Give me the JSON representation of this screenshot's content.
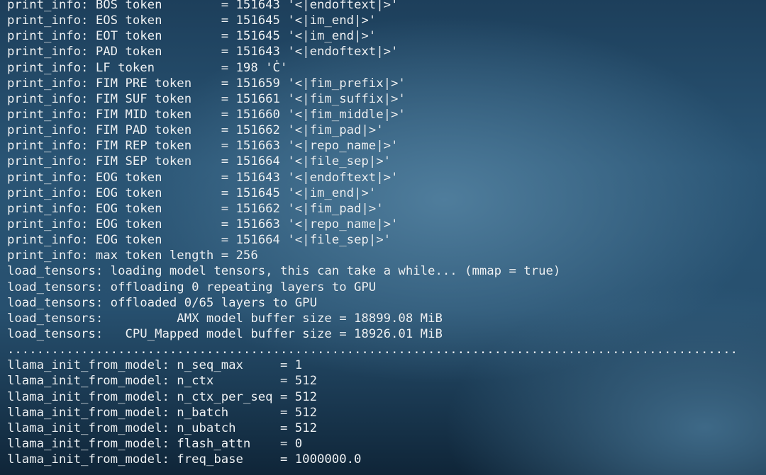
{
  "terminal": {
    "lines": [
      "print_info: BOS token        = 151643 '<|endoftext|>'",
      "print_info: EOS token        = 151645 '<|im_end|>'",
      "print_info: EOT token        = 151645 '<|im_end|>'",
      "print_info: PAD token        = 151643 '<|endoftext|>'",
      "print_info: LF token         = 198 'Ċ'",
      "print_info: FIM PRE token    = 151659 '<|fim_prefix|>'",
      "print_info: FIM SUF token    = 151661 '<|fim_suffix|>'",
      "print_info: FIM MID token    = 151660 '<|fim_middle|>'",
      "print_info: FIM PAD token    = 151662 '<|fim_pad|>'",
      "print_info: FIM REP token    = 151663 '<|repo_name|>'",
      "print_info: FIM SEP token    = 151664 '<|file_sep|>'",
      "print_info: EOG token        = 151643 '<|endoftext|>'",
      "print_info: EOG token        = 151645 '<|im_end|>'",
      "print_info: EOG token        = 151662 '<|fim_pad|>'",
      "print_info: EOG token        = 151663 '<|repo_name|>'",
      "print_info: EOG token        = 151664 '<|file_sep|>'",
      "print_info: max token length = 256",
      "load_tensors: loading model tensors, this can take a while... (mmap = true)",
      "load_tensors: offloading 0 repeating layers to GPU",
      "load_tensors: offloaded 0/65 layers to GPU",
      "load_tensors:          AMX model buffer size = 18899.08 MiB",
      "load_tensors:   CPU_Mapped model buffer size = 18926.01 MiB",
      "...................................................................................................",
      "llama_init_from_model: n_seq_max     = 1",
      "llama_init_from_model: n_ctx         = 512",
      "llama_init_from_model: n_ctx_per_seq = 512",
      "llama_init_from_model: n_batch       = 512",
      "llama_init_from_model: n_ubatch      = 512",
      "llama_init_from_model: flash_attn    = 0",
      "llama_init_from_model: freq_base     = 1000000.0"
    ]
  }
}
